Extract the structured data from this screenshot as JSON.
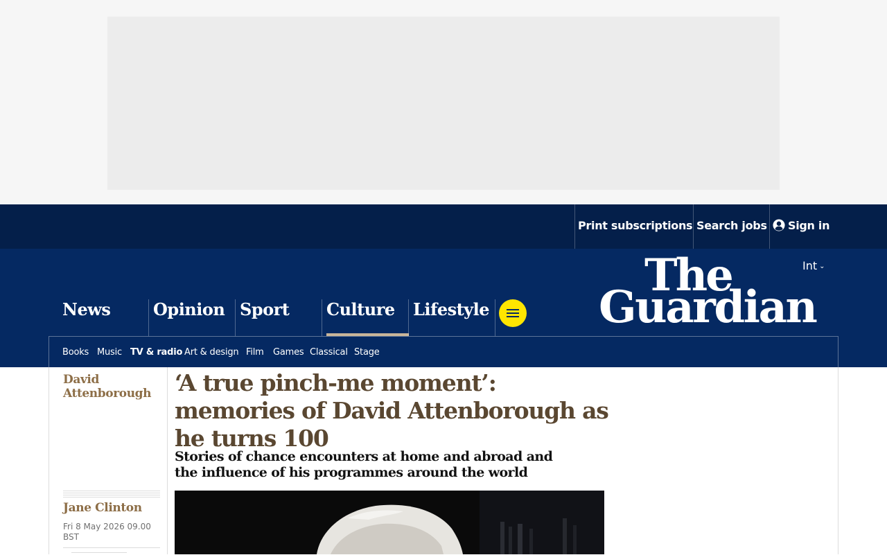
{
  "topbar": {
    "print_subscriptions": "Print subscriptions",
    "search_jobs": "Search jobs",
    "sign_in": "Sign in"
  },
  "header": {
    "edition": "Int",
    "logo_line1": "The",
    "logo_line2": "Guardian"
  },
  "pillars": [
    {
      "label": "News",
      "active": false
    },
    {
      "label": "Opinion",
      "active": false
    },
    {
      "label": "Sport",
      "active": false
    },
    {
      "label": "Culture",
      "active": true
    },
    {
      "label": "Lifestyle",
      "active": false
    }
  ],
  "subnav": [
    {
      "label": "Books"
    },
    {
      "label": "Music"
    },
    {
      "label": "TV & radio",
      "active": true
    },
    {
      "label": "Art & design"
    },
    {
      "label": "Film"
    },
    {
      "label": "Games"
    },
    {
      "label": "Classical"
    },
    {
      "label": "Stage"
    }
  ],
  "article": {
    "series": "David Attenborough",
    "headline": "‘A true pinch-me moment’: memories of David Attenborough as he turns 100",
    "standfirst": "Stories of chance encounters at home and abroad and the influence of his programmes around the world",
    "author": "Jane Clinton",
    "date": "Fri 8 May 2026 09.00 BST"
  },
  "colors": {
    "brand_dark": "#041f4a",
    "brand": "#052962",
    "menu_button": "#ffe500",
    "culture_accent": "#8d6e47",
    "headline": "#5a4731"
  },
  "icons": {
    "user": "user-circle-icon",
    "menu": "hamburger-menu-icon",
    "edition_chevron": "chevron-down-icon"
  }
}
